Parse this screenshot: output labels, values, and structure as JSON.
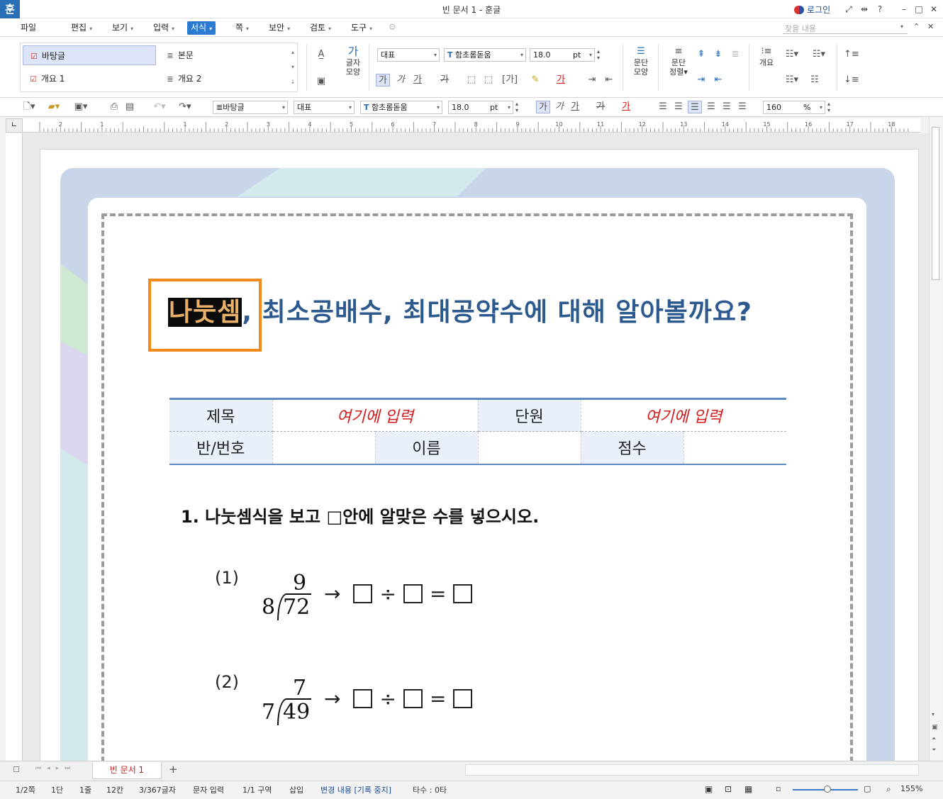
{
  "app": {
    "logo": "훈",
    "title": "빈 문서 1 - 훈글",
    "login": "로그인",
    "help": "?"
  },
  "window_buttons": [
    "minimize-icon",
    "restore-icon",
    "close-icon"
  ],
  "menu": {
    "items": [
      {
        "label": "파일",
        "caret": ""
      },
      {
        "label": "편집",
        "caret": "▾"
      },
      {
        "label": "보기",
        "caret": "▾"
      },
      {
        "label": "입력",
        "caret": "▾"
      },
      {
        "label": "서식",
        "caret": "▾"
      },
      {
        "label": "쪽",
        "caret": "▾"
      },
      {
        "label": "보안",
        "caret": "▾"
      },
      {
        "label": "검토",
        "caret": "▾"
      },
      {
        "label": "도구",
        "caret": "▾"
      }
    ],
    "active": "서식",
    "find_placeholder": "찾을 내용"
  },
  "ribbon": {
    "styles": [
      {
        "label": "바탕글",
        "selected": true
      },
      {
        "label": "개요 1",
        "selected": false
      },
      {
        "label": "본문",
        "selected": false
      },
      {
        "label": "개요 2",
        "selected": false
      }
    ],
    "char_shape": "글자\n모양",
    "char_shape_l1": "글자",
    "char_shape_l2": "모양",
    "font_lang": "대표",
    "font_name": "함초롬돋움",
    "font_size": "18.0",
    "font_unit": "pt",
    "para_shape_l1": "문단",
    "para_shape_l2": "모양",
    "para_align_l1": "문단",
    "para_align_l2": "정렬▾",
    "outline": "개요",
    "fmt_bold": "가",
    "fmt_italic": "가",
    "fmt_underline": "가",
    "fmt_strike": "가",
    "fmt_color": "가"
  },
  "toolbar2": {
    "style": "바탕글",
    "font_lang": "대표",
    "font_name": "함초롬돋움",
    "font_size": "18.0",
    "font_unit": "pt",
    "zoom": "160",
    "zoom_unit": "%"
  },
  "ruler": {
    "ticks": [
      "2",
      "1",
      "",
      "1",
      "2",
      "3",
      "4",
      "5",
      "6",
      "7",
      "8",
      "9",
      "10",
      "11",
      "12",
      "13",
      "14",
      "15",
      "16",
      "17",
      "18"
    ]
  },
  "document": {
    "title_highlight": "나눗셈",
    "title_rest": ", 최소공배수, 최대공약수에 대해 알아볼까요?",
    "info_table": {
      "r1": {
        "l1": "제목",
        "v1": "여기에 입력",
        "l2": "단원",
        "v2": "여기에 입력"
      },
      "r2": {
        "l1": "반/번호",
        "l2": "이름",
        "l3": "점수"
      }
    },
    "q1": "1. 나눗셈식을 보고 □안에 알맞은 수를 넣으시오.",
    "problems": [
      {
        "label": "(1)",
        "quotient": "9",
        "divisor": "8",
        "dividend": "72",
        "arrow": "→",
        "div": "÷",
        "eq": "="
      },
      {
        "label": "(2)",
        "quotient": "7",
        "divisor": "7",
        "dividend": "49",
        "arrow": "→",
        "div": "÷",
        "eq": "="
      }
    ]
  },
  "tabs": {
    "doc": "빈 문서 1",
    "add": "+"
  },
  "status": {
    "page": "1/2쪽",
    "col": "1단",
    "line": "1줄",
    "char": "12칸",
    "chars": "3/367글자",
    "mode": "문자 입력",
    "section": "1/1 구역",
    "insert": "삽입",
    "track": "변경 내용 [기록 중지]",
    "typing": "타수 : 0타",
    "zoom": "155%"
  },
  "colors": {
    "accent": "#2a7bd1",
    "title": "#2c5a8f",
    "highlight_text": "#e9b06a",
    "frame": "#f28a1c",
    "red_text": "#d21a1a"
  }
}
